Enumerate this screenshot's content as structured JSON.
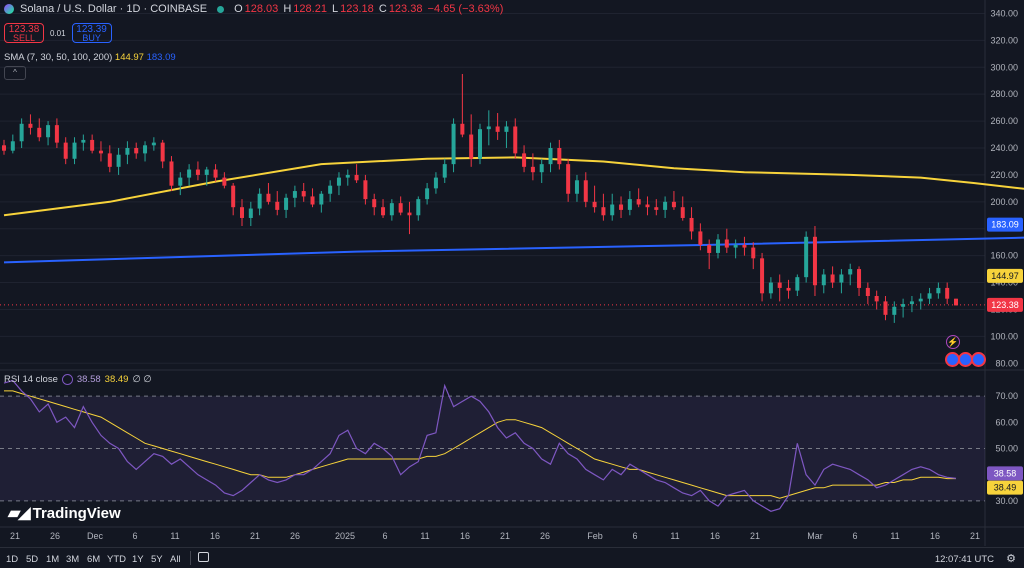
{
  "header": {
    "title": "Solana / U.S. Dollar · 1D · COINBASE",
    "ohlc": [
      {
        "label": "O",
        "value": "128.03"
      },
      {
        "label": "H",
        "value": "128.21"
      },
      {
        "label": "L",
        "value": "123.18"
      },
      {
        "label": "C",
        "value": "123.38"
      },
      {
        "label": "",
        "value": "−4.65 (−3.63%)"
      }
    ]
  },
  "trade": {
    "sell_price": "123.38",
    "sell_label": "SELL",
    "spread": "0.01",
    "buy_price": "123.39",
    "buy_label": "BUY"
  },
  "sma_legend": {
    "label": "SMA (7, 30, 50, 100, 200)",
    "v1": "144.97",
    "v2": "183.09"
  },
  "rsi_legend": {
    "label": "RSI 14 close",
    "v1": "38.58",
    "v2": "38.49",
    "extra": "∅ ∅"
  },
  "brand": "TradingView",
  "ranges": [
    "1D",
    "5D",
    "1M",
    "3M",
    "6M",
    "YTD",
    "1Y",
    "5Y",
    "All"
  ],
  "clock": "12:07:41 UTC",
  "colors": {
    "up": "#26a69a",
    "down": "#f23645",
    "sma_short": "#f7d33b",
    "sma_long": "#2962ff",
    "rsi": "#7e57c2",
    "rsi_ma": "#f7d33b",
    "background": "#131722"
  },
  "chart_data": [
    {
      "type": "candlestick",
      "title": "Solana / U.S. Dollar · 1D · COINBASE",
      "ylim": [
        75,
        350
      ],
      "y_ticks": [
        "80.00",
        "100.00",
        "120.00",
        "140.00",
        "160.00",
        "180.00",
        "200.00",
        "220.00",
        "240.00",
        "260.00",
        "280.00",
        "300.00",
        "320.00",
        "340.00"
      ],
      "x_ticks": [
        "21",
        "26",
        "Dec",
        "6",
        "11",
        "16",
        "21",
        "26",
        "2025",
        "6",
        "11",
        "16",
        "21",
        "26",
        "Feb",
        "6",
        "11",
        "16",
        "21",
        "Mar",
        "6",
        "11",
        "16",
        "21"
      ],
      "price_tags": [
        {
          "value": 183.09,
          "label": "183.09",
          "color": "#2962ff"
        },
        {
          "value": 144.97,
          "label": "144.97",
          "color": "#f7d33b"
        },
        {
          "value": 123.38,
          "label": "123.38",
          "color": "#f23645"
        }
      ],
      "candles_ohlc": [
        [
          242,
          246,
          235,
          238
        ],
        [
          238,
          250,
          236,
          245
        ],
        [
          245,
          262,
          240,
          258
        ],
        [
          258,
          265,
          250,
          255
        ],
        [
          255,
          262,
          245,
          248
        ],
        [
          248,
          260,
          242,
          257
        ],
        [
          257,
          262,
          240,
          244
        ],
        [
          244,
          248,
          228,
          232
        ],
        [
          232,
          248,
          228,
          244
        ],
        [
          244,
          250,
          238,
          246
        ],
        [
          246,
          250,
          236,
          238
        ],
        [
          238,
          245,
          230,
          236
        ],
        [
          236,
          242,
          222,
          226
        ],
        [
          226,
          240,
          220,
          235
        ],
        [
          235,
          245,
          228,
          240
        ],
        [
          240,
          244,
          232,
          236
        ],
        [
          236,
          245,
          230,
          242
        ],
        [
          242,
          248,
          238,
          244
        ],
        [
          244,
          246,
          225,
          230
        ],
        [
          230,
          234,
          208,
          212
        ],
        [
          212,
          222,
          205,
          218
        ],
        [
          218,
          228,
          212,
          224
        ],
        [
          224,
          230,
          216,
          220
        ],
        [
          220,
          226,
          212,
          224
        ],
        [
          224,
          228,
          215,
          218
        ],
        [
          218,
          222,
          210,
          212
        ],
        [
          212,
          214,
          190,
          196
        ],
        [
          196,
          202,
          182,
          188
        ],
        [
          188,
          200,
          182,
          195
        ],
        [
          195,
          210,
          190,
          206
        ],
        [
          206,
          214,
          198,
          200
        ],
        [
          200,
          208,
          190,
          194
        ],
        [
          194,
          206,
          188,
          203
        ],
        [
          203,
          212,
          196,
          208
        ],
        [
          208,
          214,
          200,
          204
        ],
        [
          204,
          210,
          196,
          198
        ],
        [
          198,
          208,
          192,
          206
        ],
        [
          206,
          216,
          200,
          212
        ],
        [
          212,
          222,
          205,
          218
        ],
        [
          218,
          224,
          212,
          220
        ],
        [
          220,
          228,
          214,
          216
        ],
        [
          216,
          220,
          198,
          202
        ],
        [
          202,
          206,
          190,
          196
        ],
        [
          196,
          202,
          188,
          190
        ],
        [
          190,
          202,
          186,
          199
        ],
        [
          199,
          204,
          190,
          192
        ],
        [
          192,
          200,
          176,
          190
        ],
        [
          190,
          204,
          186,
          202
        ],
        [
          202,
          214,
          198,
          210
        ],
        [
          210,
          222,
          206,
          218
        ],
        [
          218,
          232,
          214,
          228
        ],
        [
          228,
          262,
          222,
          258
        ],
        [
          258,
          295,
          248,
          250
        ],
        [
          250,
          265,
          226,
          232
        ],
        [
          232,
          258,
          228,
          254
        ],
        [
          254,
          268,
          242,
          256
        ],
        [
          256,
          266,
          246,
          252
        ],
        [
          252,
          260,
          240,
          256
        ],
        [
          256,
          262,
          232,
          236
        ],
        [
          236,
          242,
          222,
          226
        ],
        [
          226,
          236,
          216,
          222
        ],
        [
          222,
          232,
          214,
          228
        ],
        [
          228,
          244,
          222,
          240
        ],
        [
          240,
          246,
          224,
          228
        ],
        [
          228,
          232,
          200,
          206
        ],
        [
          206,
          220,
          200,
          216
        ],
        [
          216,
          222,
          196,
          200
        ],
        [
          200,
          212,
          192,
          196
        ],
        [
          196,
          206,
          186,
          190
        ],
        [
          190,
          206,
          186,
          198
        ],
        [
          198,
          204,
          188,
          194
        ],
        [
          194,
          208,
          190,
          202
        ],
        [
          202,
          210,
          196,
          198
        ],
        [
          198,
          204,
          190,
          196
        ],
        [
          196,
          202,
          190,
          194
        ],
        [
          194,
          204,
          188,
          200
        ],
        [
          200,
          208,
          194,
          196
        ],
        [
          196,
          204,
          186,
          188
        ],
        [
          188,
          196,
          172,
          178
        ],
        [
          178,
          184,
          164,
          168
        ],
        [
          168,
          172,
          150,
          162
        ],
        [
          162,
          176,
          158,
          172
        ],
        [
          172,
          180,
          162,
          166
        ],
        [
          166,
          172,
          158,
          168
        ],
        [
          168,
          174,
          160,
          166
        ],
        [
          166,
          170,
          150,
          158
        ],
        [
          158,
          162,
          126,
          132
        ],
        [
          132,
          144,
          128,
          140
        ],
        [
          140,
          146,
          126,
          136
        ],
        [
          136,
          142,
          128,
          134
        ],
        [
          134,
          146,
          130,
          144
        ],
        [
          144,
          178,
          140,
          174
        ],
        [
          174,
          182,
          130,
          138
        ],
        [
          138,
          150,
          132,
          146
        ],
        [
          146,
          152,
          136,
          140
        ],
        [
          140,
          150,
          132,
          146
        ],
        [
          146,
          154,
          138,
          150
        ],
        [
          150,
          152,
          130,
          136
        ],
        [
          136,
          140,
          124,
          130
        ],
        [
          130,
          134,
          120,
          126
        ],
        [
          126,
          130,
          112,
          116
        ],
        [
          116,
          126,
          110,
          122
        ],
        [
          122,
          128,
          114,
          124
        ],
        [
          124,
          130,
          118,
          126
        ],
        [
          126,
          132,
          120,
          128
        ],
        [
          128,
          136,
          124,
          132
        ],
        [
          132,
          140,
          128,
          136
        ],
        [
          136,
          140,
          124,
          128
        ],
        [
          128,
          128,
          123,
          123
        ]
      ],
      "sma_short": [
        [
          0,
          190
        ],
        [
          12,
          200
        ],
        [
          24,
          215
        ],
        [
          36,
          228
        ],
        [
          48,
          232
        ],
        [
          58,
          233
        ],
        [
          68,
          230
        ],
        [
          76,
          225
        ],
        [
          84,
          222
        ],
        [
          96,
          220
        ],
        [
          104,
          218
        ],
        [
          110,
          214
        ],
        [
          118,
          208
        ],
        [
          128,
          202
        ],
        [
          138,
          200
        ],
        [
          148,
          198
        ],
        [
          155,
          202
        ],
        [
          162,
          208
        ],
        [
          172,
          215
        ],
        [
          182,
          221
        ],
        [
          192,
          226
        ],
        [
          200,
          226
        ],
        [
          210,
          222
        ],
        [
          220,
          212
        ],
        [
          228,
          200
        ],
        [
          236,
          185
        ],
        [
          244,
          172
        ],
        [
          252,
          160
        ],
        [
          260,
          150
        ],
        [
          267,
          145
        ]
      ],
      "sma_long": [
        [
          0,
          155
        ],
        [
          40,
          163
        ],
        [
          80,
          168
        ],
        [
          120,
          174
        ],
        [
          160,
          182
        ],
        [
          180,
          184
        ],
        [
          200,
          186
        ],
        [
          230,
          187
        ],
        [
          267,
          185
        ]
      ]
    },
    {
      "type": "line",
      "title": "RSI 14 close",
      "ylim": [
        20,
        80
      ],
      "y_ticks": [
        "30.00",
        "40.00",
        "50.00",
        "60.00",
        "70.00"
      ],
      "levels": [
        30,
        50,
        70
      ],
      "value_tags": [
        {
          "value": 38.58,
          "label": "38.58",
          "color": "#7e57c2"
        },
        {
          "value": 38.49,
          "label": "38.49",
          "color": "#f7d33b"
        }
      ],
      "series": [
        {
          "values": [
            75,
            76,
            72,
            69,
            64,
            67,
            60,
            62,
            58,
            66,
            60,
            55,
            52,
            50,
            45,
            42,
            45,
            48,
            47,
            44,
            46,
            43,
            40,
            38,
            36,
            33,
            32,
            34,
            37,
            40,
            38,
            37,
            38,
            40,
            40,
            42,
            45,
            48,
            55,
            57,
            50,
            48,
            52,
            50,
            47,
            40,
            43,
            45,
            55,
            56,
            74,
            66,
            68,
            70,
            68,
            64,
            58,
            54,
            56,
            52,
            50,
            46,
            44,
            52,
            48,
            46,
            42,
            40,
            38,
            42,
            40,
            44,
            42,
            40,
            38,
            37,
            35,
            33,
            32,
            34,
            30,
            28,
            32,
            33,
            34,
            30,
            28,
            26,
            27,
            32,
            52,
            40,
            36,
            42,
            44,
            43,
            42,
            40,
            38,
            35,
            36,
            38,
            40,
            42,
            43,
            42,
            40,
            39,
            38.58
          ]
        },
        {
          "values": [
            72,
            72,
            71,
            70,
            69,
            68,
            67,
            66,
            65,
            64,
            63,
            62,
            60,
            58,
            56,
            54,
            52,
            51,
            50,
            49,
            48,
            47,
            46,
            45,
            44,
            43,
            42,
            41,
            40,
            40,
            39,
            39,
            39,
            40,
            41,
            42,
            43,
            44,
            45,
            46,
            46,
            46,
            46,
            46,
            46,
            46,
            46,
            46,
            47,
            47,
            48,
            50,
            52,
            54,
            56,
            58,
            60,
            61,
            61,
            60,
            59,
            58,
            56,
            54,
            52,
            50,
            48,
            46,
            45,
            44,
            43,
            42,
            42,
            41,
            40,
            39,
            38,
            37,
            36,
            35,
            34,
            33,
            32,
            32,
            32,
            32,
            32,
            32,
            31,
            32,
            33,
            34,
            35,
            35,
            36,
            36,
            36,
            36,
            36,
            36,
            37,
            37,
            38,
            38,
            39,
            39,
            39,
            38.5,
            38.49
          ]
        }
      ]
    }
  ]
}
